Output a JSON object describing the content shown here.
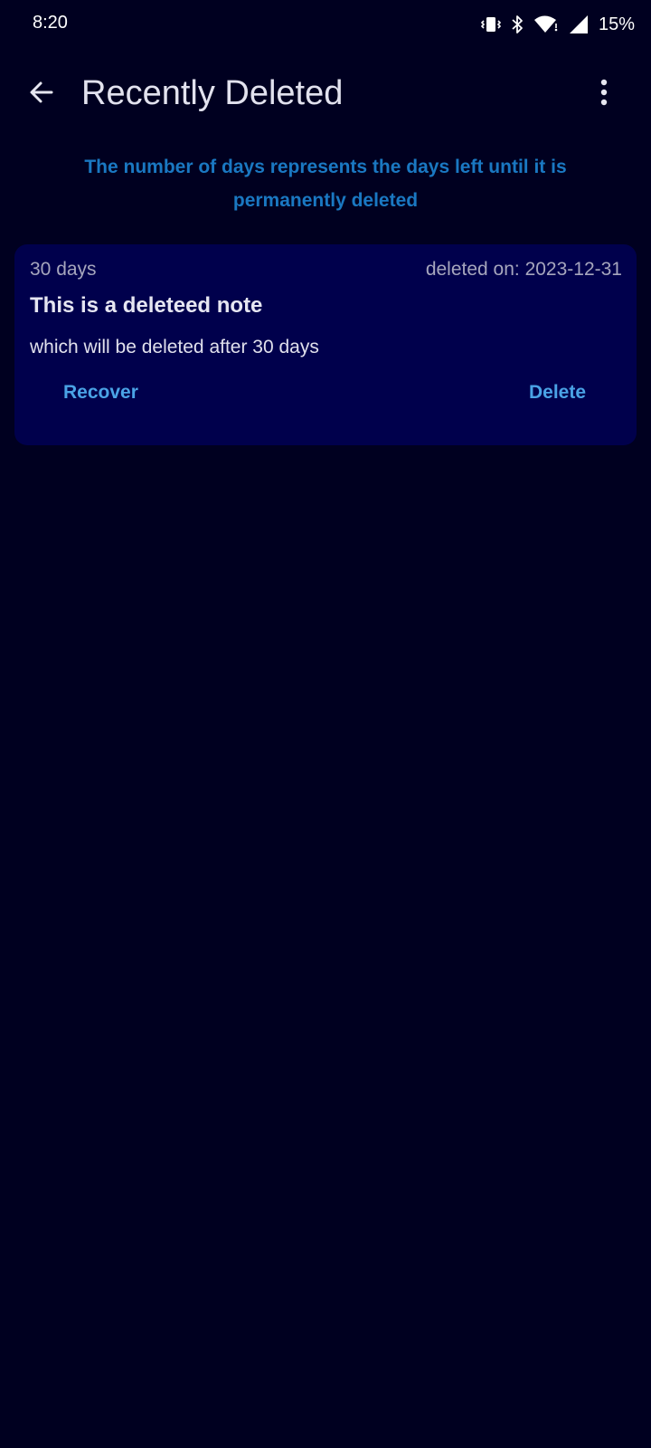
{
  "status_bar": {
    "time": "8:20",
    "battery": "15%",
    "icons": [
      "vibrate-icon",
      "bluetooth-icon",
      "wifi-icon",
      "signal-icon"
    ]
  },
  "app_bar": {
    "title": "Recently Deleted",
    "back_icon": "arrow-left-icon",
    "menu_icon": "more-vertical-icon"
  },
  "info": {
    "text": "The number of days represents the days left until it is permanently deleted"
  },
  "notes": [
    {
      "days_left": "30 days",
      "deleted_on": "deleted on: 2023-12-31",
      "title": "This is a deleteed note",
      "body": "which will be deleted after 30 days",
      "recover_label": "Recover",
      "delete_label": "Delete"
    }
  ],
  "colors": {
    "background": "#000020",
    "card": "#00004c",
    "accent": "#4aa3e6",
    "info_text": "#1a78c2"
  }
}
